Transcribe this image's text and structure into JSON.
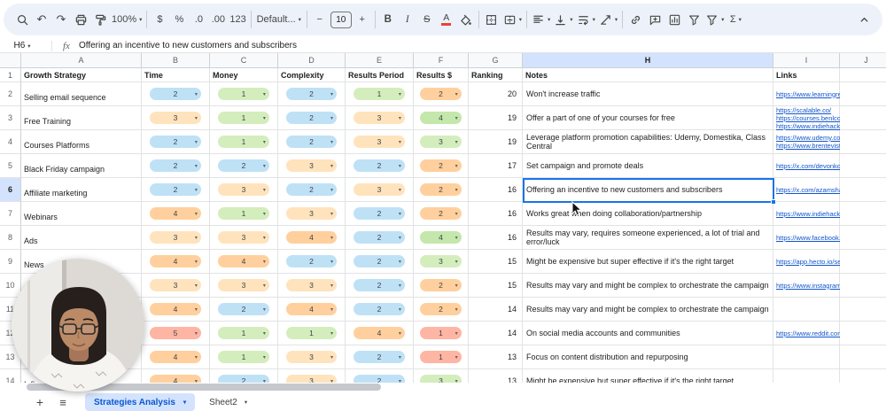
{
  "icons": {
    "undo": "↶",
    "redo": "↷",
    "caret": "▾",
    "hamburger": "≡"
  },
  "toolbar": {
    "zoom": "100%",
    "currency": "$",
    "percent": "%",
    "decrease_decimal": ".0",
    "increase_decimal": ".00",
    "more_formats": "123",
    "font_name": "Default...",
    "font_size": "10",
    "decrease_font_size": "−",
    "increase_font_size": "+",
    "bold": "B",
    "italic": "I",
    "strikethrough": "S",
    "text_color": "A",
    "functions": "Σ"
  },
  "formula_bar": {
    "cell_ref": "H6",
    "fx_label": "fx",
    "content": "Offering an incentive to new customers and subscribers"
  },
  "sheet": {
    "col_letters": [
      "A",
      "B",
      "C",
      "D",
      "E",
      "F",
      "G",
      "H",
      "I",
      "J"
    ],
    "headers": [
      "Growth Strategy",
      "Time",
      "Money",
      "Complexity",
      "Results Period",
      "Results $",
      "Ranking",
      "Notes",
      "Links",
      ""
    ],
    "selection": {
      "ref": "H6",
      "row": 6,
      "col": "H"
    },
    "chip_colors": {
      "scale": {
        "1": "#d4edbc",
        "2": "#bfe1f6",
        "3": "#ffe3bd",
        "4": "#ffd09d",
        "5": "#ffb5a3"
      },
      "results": {
        "1": "#ffb5a3",
        "2": "#ffd09d",
        "3": "#d4edbc",
        "4": "#c4e7ab",
        "5": "#b5e0a0"
      }
    },
    "rows": [
      {
        "n": 2,
        "strategy": "Selling email sequence",
        "chips": [
          2,
          1,
          2,
          1,
          2
        ],
        "ranking": 20,
        "notes": "Won't increase traffic",
        "links": [
          "https://www.learningrevolut"
        ]
      },
      {
        "n": 3,
        "strategy": "Free Training",
        "chips": [
          3,
          1,
          2,
          3,
          4
        ],
        "ranking": 19,
        "notes": "Offer a part of one of your courses for free",
        "links": [
          "https://scalable.co/",
          "https://courses.benlcollins.c",
          "https://www.indiehackers.c"
        ]
      },
      {
        "n": 4,
        "strategy": "Courses Platforms",
        "chips": [
          2,
          1,
          2,
          3,
          3
        ],
        "ranking": 19,
        "notes": "Leverage platform promotion capabilities: Udemy, Domestika, Class Central",
        "links": [
          "https://www.udemy.com/co",
          "https://www.brenteviston.c"
        ]
      },
      {
        "n": 5,
        "strategy": "Black Friday campaign",
        "chips": [
          2,
          2,
          3,
          2,
          2
        ],
        "ranking": 17,
        "notes": "Set campaign and promote deals",
        "links": [
          "https://x.com/devonko_/sta"
        ]
      },
      {
        "n": 6,
        "strategy": "Affiliate marketing",
        "chips": [
          2,
          3,
          2,
          3,
          2
        ],
        "ranking": 16,
        "notes": "Offering an incentive to new customers and subscribers",
        "links": [
          "https://x.com/azamsharp/st"
        ]
      },
      {
        "n": 7,
        "strategy": "Webinars",
        "chips": [
          4,
          1,
          3,
          2,
          2
        ],
        "ranking": 16,
        "notes": "Works great when doing collaboration/partnership",
        "links": [
          "https://www.indiehackers.c"
        ]
      },
      {
        "n": 8,
        "strategy": "Ads",
        "chips": [
          3,
          3,
          4,
          2,
          4
        ],
        "ranking": 16,
        "notes": "Results may vary, requires someone experienced, a lot of trial and error/luck",
        "links": [
          "https://www.facebook.com/"
        ]
      },
      {
        "n": 9,
        "strategy": "News",
        "chips": [
          4,
          4,
          2,
          2,
          3
        ],
        "ranking": 15,
        "notes": "Might be expensive but super effective if it's the right target",
        "links": [
          "https://app.hecto.io/search"
        ]
      },
      {
        "n": 10,
        "strategy": "",
        "chips": [
          3,
          3,
          3,
          2,
          2
        ],
        "ranking": 15,
        "notes": "Results may vary and might be complex to orchestrate the campaign",
        "links": [
          "https://www.instagram.com"
        ]
      },
      {
        "n": 11,
        "strategy": "",
        "chips": [
          4,
          2,
          4,
          2,
          2
        ],
        "ranking": 14,
        "notes": "Results may vary and might be complex to orchestrate the campaign",
        "links": []
      },
      {
        "n": 12,
        "strategy": "",
        "chips": [
          5,
          1,
          1,
          4,
          1
        ],
        "ranking": 14,
        "notes": "On social media accounts and communities",
        "links": [
          "https://www.reddit.com/r/le"
        ]
      },
      {
        "n": 13,
        "strategy": "",
        "chips": [
          4,
          1,
          3,
          2,
          1
        ],
        "ranking": 13,
        "notes": "Focus on content distribution and repurposing",
        "links": []
      },
      {
        "n": 14,
        "strategy": "Influ",
        "chips": [
          4,
          2,
          3,
          2,
          3
        ],
        "ranking": 13,
        "notes": "Might be expensive but super effective if it's the right target.",
        "links": []
      }
    ]
  },
  "tabs": {
    "add": "+",
    "active": "Strategies Analysis",
    "second": "Sheet2"
  }
}
